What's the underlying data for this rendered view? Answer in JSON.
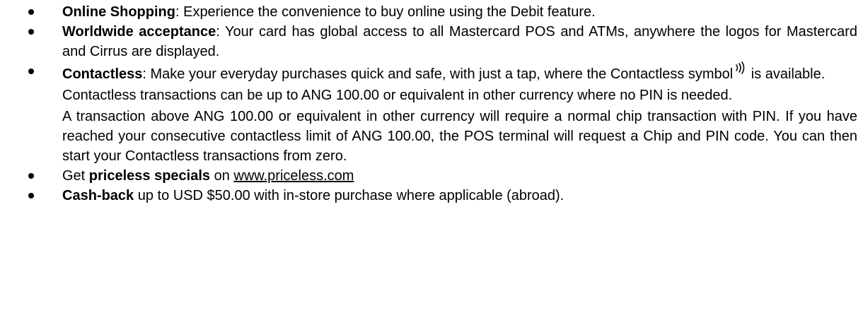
{
  "items": [
    {
      "bold": "Online Shopping",
      "text": ": Experience the convenience to buy online using the Debit feature."
    },
    {
      "bold": "Worldwide acceptance",
      "text": ": Your card has global access to all Mastercard POS and ATMs, anywhere the logos for Mastercard and Cirrus are displayed."
    },
    {
      "bold": "Contactless",
      "text_before_icon": ": Make your everyday purchases quick and safe, with just a tap, where the Contactless symbol",
      "icon": "contactless-icon",
      "text_after_icon": " is available.",
      "para2": "Contactless transactions can be up to ANG 100.00 or equivalent in other currency where no PIN is needed.",
      "para3": "A transaction above ANG 100.00 or equivalent in other currency will require a normal chip transaction with PIN. If you have reached your consecutive contactless limit of ANG 100.00, the POS terminal will request a Chip and PIN code. You can then start your Contactless transactions from zero."
    },
    {
      "pre": "Get ",
      "bold": "priceless specials",
      "mid": " on ",
      "link": "www.priceless.com"
    },
    {
      "bold": "Cash-back",
      "text": " up to USD $50.00 with in-store purchase where applicable (abroad)."
    }
  ]
}
